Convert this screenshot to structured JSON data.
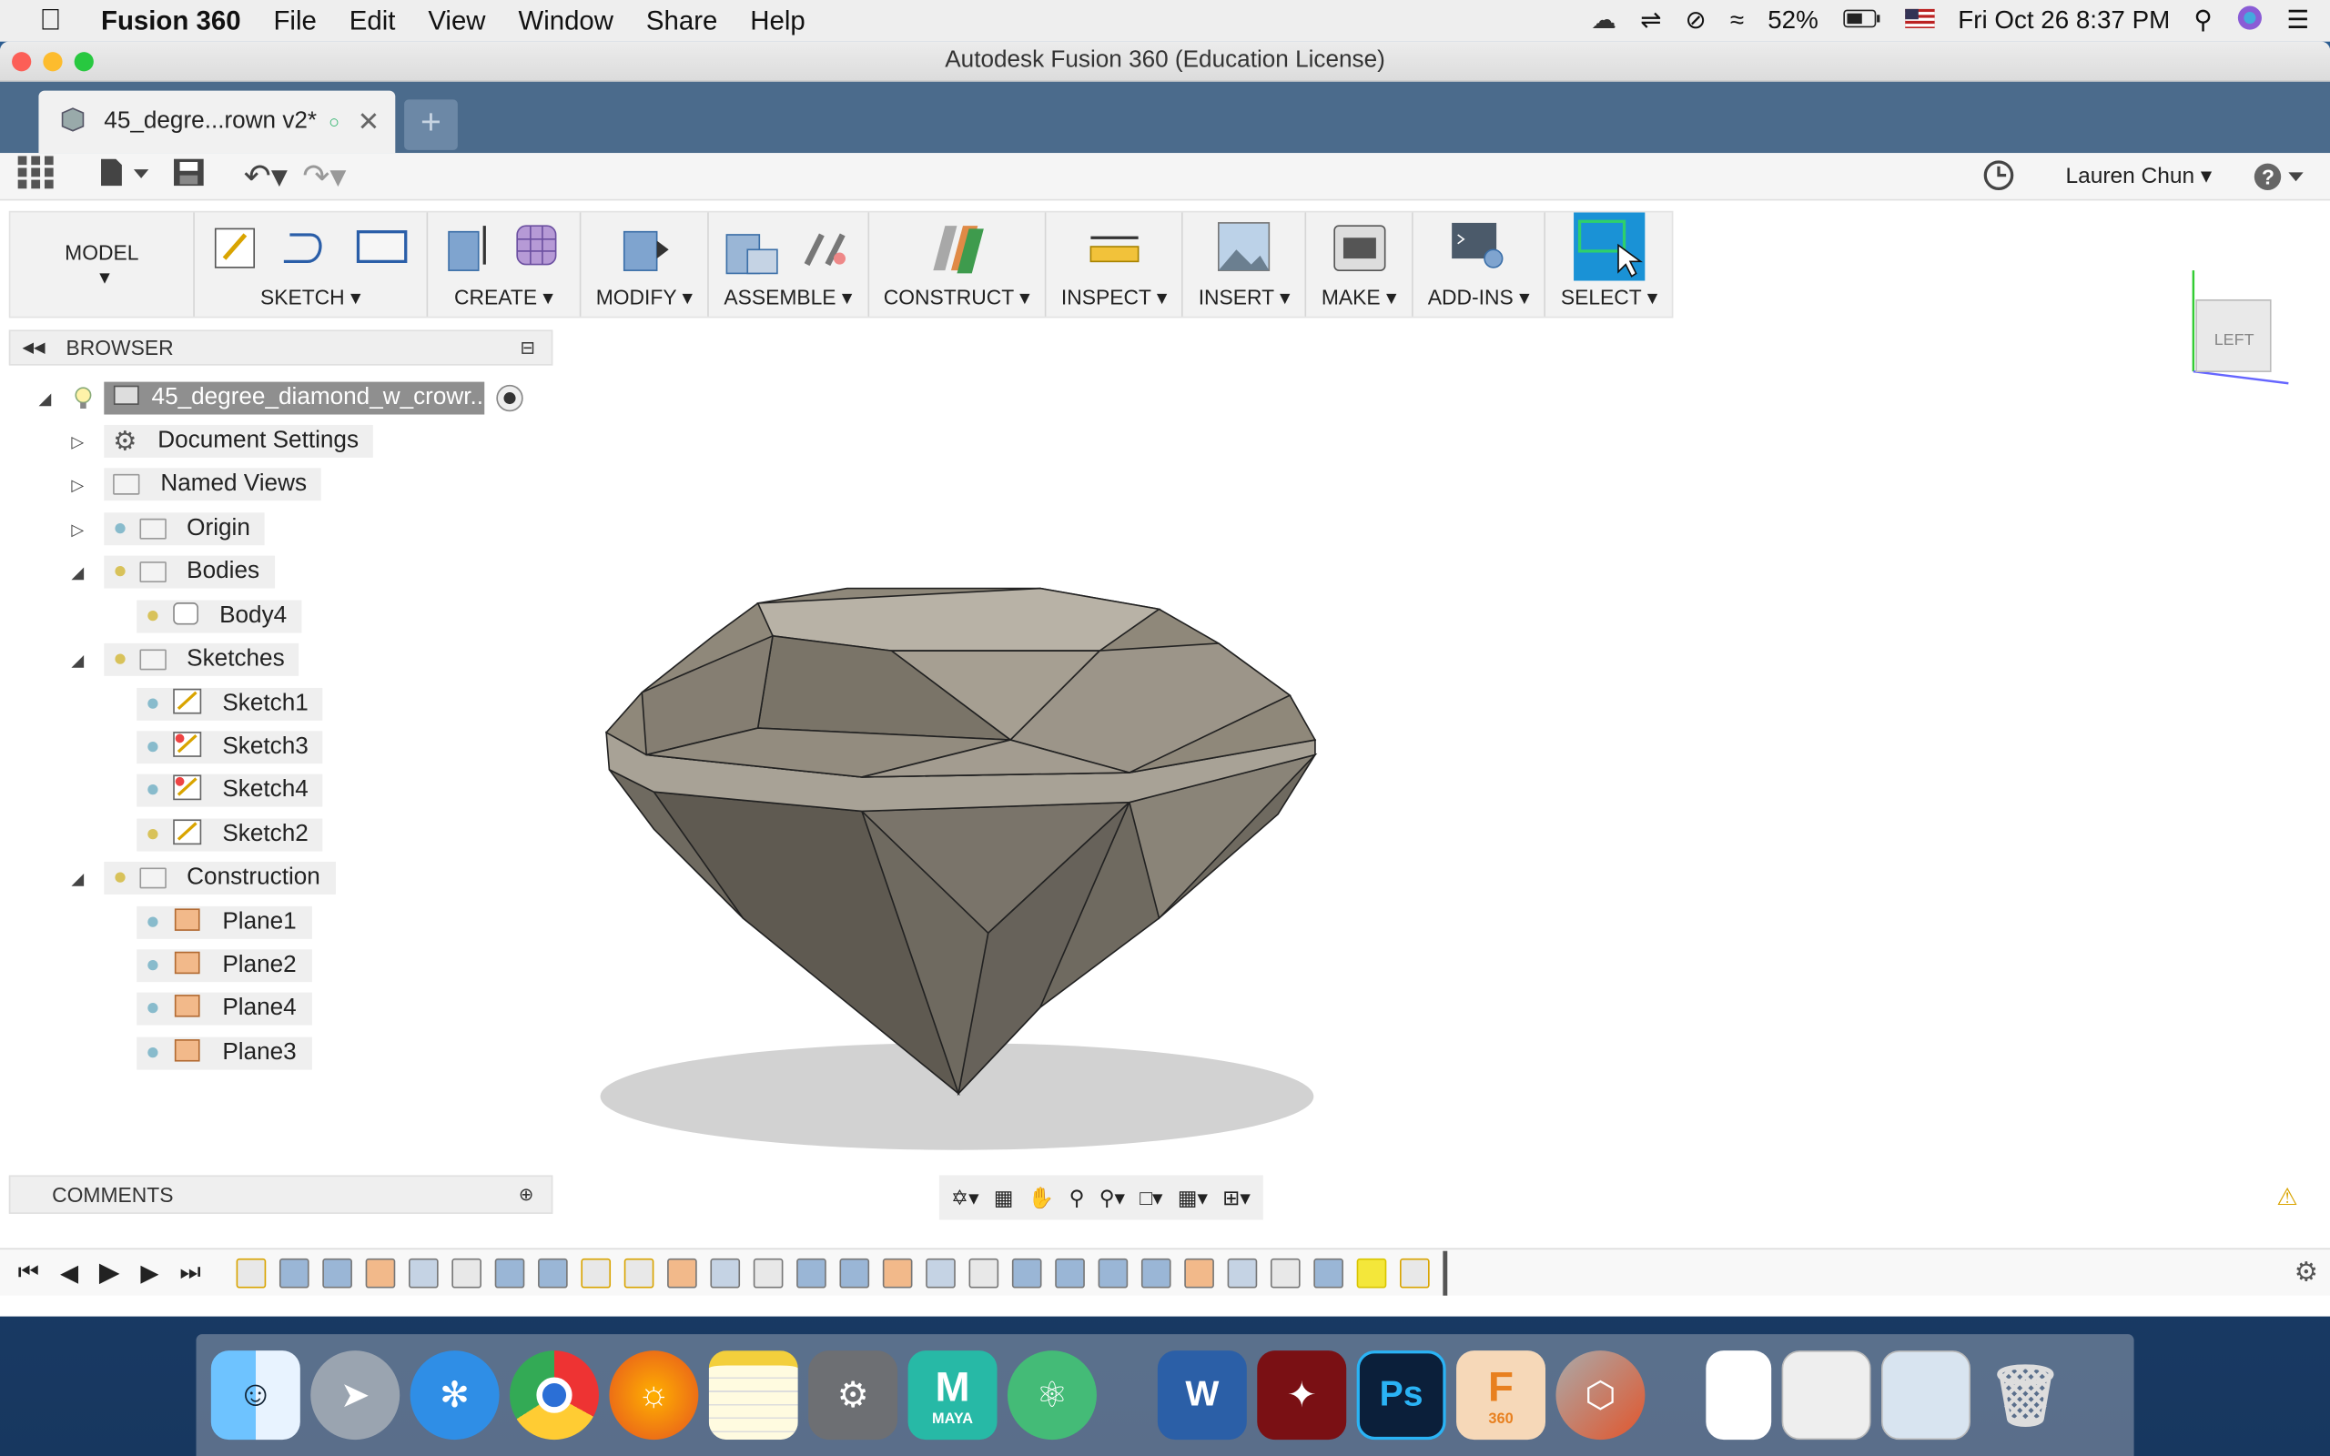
{
  "menubar": {
    "app": "Fusion 360",
    "items": [
      "File",
      "Edit",
      "View",
      "Window",
      "Share",
      "Help"
    ],
    "battery": "52%",
    "clock": "Fri Oct 26  8:37 PM"
  },
  "window": {
    "title": "Autodesk Fusion 360 (Education License)"
  },
  "tab": {
    "name": "45_degre...rown v2*"
  },
  "header": {
    "user": "Lauren Chun"
  },
  "toolbar": {
    "workspace": "MODEL",
    "groups": [
      "SKETCH",
      "CREATE",
      "MODIFY",
      "ASSEMBLE",
      "CONSTRUCT",
      "INSPECT",
      "INSERT",
      "MAKE",
      "ADD-INS",
      "SELECT"
    ]
  },
  "browser": {
    "title": "BROWSER",
    "root": "45_degree_diamond_w_crowr...",
    "items": {
      "doc_settings": "Document Settings",
      "named_views": "Named Views",
      "origin": "Origin",
      "bodies": "Bodies",
      "body4": "Body4",
      "sketches": "Sketches",
      "sketch1": "Sketch1",
      "sketch3": "Sketch3",
      "sketch4": "Sketch4",
      "sketch2": "Sketch2",
      "construction": "Construction",
      "plane1": "Plane1",
      "plane2": "Plane2",
      "plane4": "Plane4",
      "plane3": "Plane3"
    }
  },
  "comments": {
    "title": "COMMENTS"
  },
  "viewcube": {
    "face": "LEFT"
  },
  "colors": {
    "accent": "#1a92d6",
    "tabbar": "#4b6b8c",
    "diamond": "#8f887a"
  },
  "dock": {
    "apps": [
      "Finder",
      "Launchpad",
      "Safari",
      "Chrome",
      "Firefox",
      "Notes",
      "System Preferences",
      "Maya",
      "Atom",
      "Word",
      "Acrobat",
      "Photoshop",
      "Fusion 360",
      "Fusion Launcher",
      "Document",
      "Preview PDF",
      "Screenshot",
      "Trash"
    ],
    "maya_label": "MAYA",
    "fusion_label": "360"
  }
}
